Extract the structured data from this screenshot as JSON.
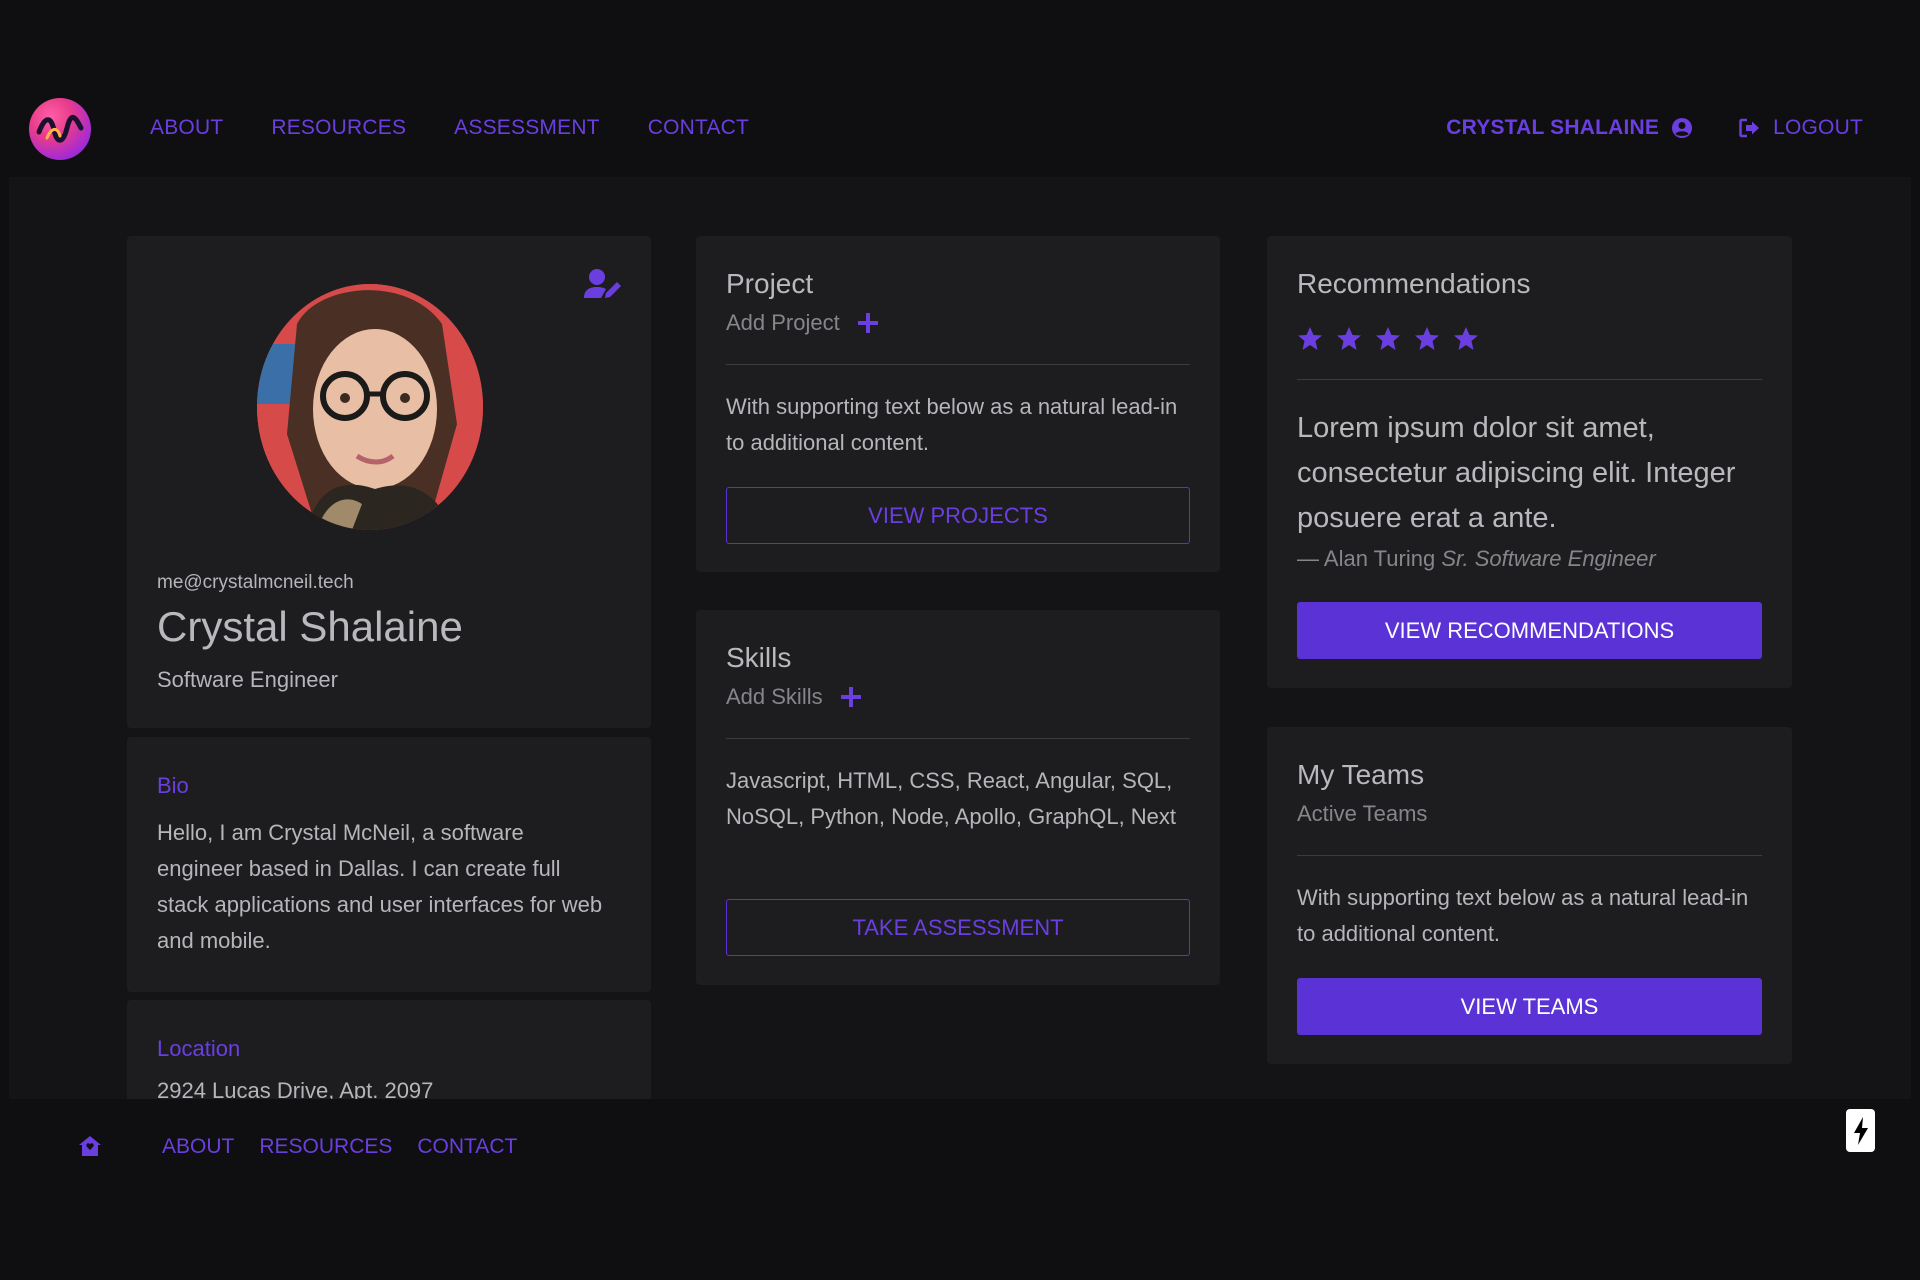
{
  "nav": {
    "links": [
      "ABOUT",
      "RESOURCES",
      "ASSESSMENT",
      "CONTACT"
    ],
    "user_name": "CRYSTAL SHALAINE",
    "logout": "LOGOUT"
  },
  "profile": {
    "email": "me@crystalmcneil.tech",
    "name": "Crystal Shalaine",
    "role": "Software Engineer"
  },
  "bio": {
    "title": "Bio",
    "text": "Hello, I am Crystal McNeil, a software engineer based in Dallas. I can create full stack applications and user interfaces for web and mobile."
  },
  "location": {
    "title": "Location",
    "text": "2924 Lucas Drive, Apt. 2097"
  },
  "project": {
    "title": "Project",
    "subtitle": "Add Project",
    "text": "With supporting text below as a natural lead-in to additional content.",
    "button": "VIEW PROJECTS"
  },
  "skills": {
    "title": "Skills",
    "subtitle": "Add Skills",
    "text": "Javascript, HTML, CSS, React, Angular, SQL, NoSQL, Python, Node, Apollo, GraphQL, Next",
    "button": "TAKE ASSESSMENT"
  },
  "recommendations": {
    "title": "Recommendations",
    "rating": 5,
    "quote": "Lorem ipsum dolor sit amet, consectetur adipiscing elit. Integer posuere erat a ante.",
    "author": "— Alan Turing",
    "author_title": "Sr. Software Engineer",
    "button": "VIEW RECOMMENDATIONS"
  },
  "teams": {
    "title": "My Teams",
    "subtitle": "Active Teams",
    "text": "With supporting text below as a natural lead-in to additional content.",
    "button": "VIEW TEAMS"
  },
  "footer": {
    "links": [
      "ABOUT",
      "RESOURCES",
      "CONTACT"
    ]
  },
  "colors": {
    "accent": "#5a32d6",
    "accent_text": "#6b3ee0",
    "background": "#0f0f11",
    "card": "#1d1d20"
  },
  "icons": [
    "logo-icon",
    "user-circle-icon",
    "logout-icon",
    "user-edit-icon",
    "plus-icon",
    "star-icon",
    "home-icon",
    "bolt-icon"
  ]
}
